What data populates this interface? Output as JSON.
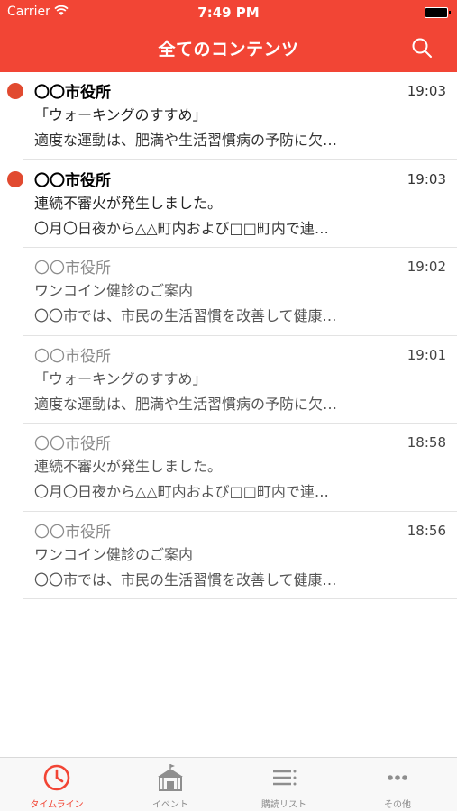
{
  "status_bar": {
    "carrier": "Carrier",
    "time": "7:49 PM"
  },
  "nav": {
    "title": "全てのコンテンツ",
    "search_icon": "search-icon"
  },
  "items": [
    {
      "sender": "〇〇市役所",
      "time": "19:03",
      "title": "「ウォーキングのすすめ」",
      "body": "適度な運動は、肥満や生活習慣病の予防に欠…",
      "unread": true
    },
    {
      "sender": "〇〇市役所",
      "time": "19:03",
      "title": "連続不審火が発生しました。",
      "body": "〇月〇日夜から△△町内および□□町内で連…",
      "unread": true
    },
    {
      "sender": "〇〇市役所",
      "time": "19:02",
      "title": "ワンコイン健診のご案内",
      "body": "〇〇市では、市民の生活習慣を改善して健康…",
      "unread": false
    },
    {
      "sender": "〇〇市役所",
      "time": "19:01",
      "title": "「ウォーキングのすすめ」",
      "body": "適度な運動は、肥満や生活習慣病の予防に欠…",
      "unread": false
    },
    {
      "sender": "〇〇市役所",
      "time": "18:58",
      "title": "連続不審火が発生しました。",
      "body": "〇月〇日夜から△△町内および□□町内で連…",
      "unread": false
    },
    {
      "sender": "〇〇市役所",
      "time": "18:56",
      "title": "ワンコイン健診のご案内",
      "body": "〇〇市では、市民の生活習慣を改善して健康…",
      "unread": false
    }
  ],
  "tabs": [
    {
      "label": "タイムライン",
      "icon": "clock-icon",
      "active": true
    },
    {
      "label": "イベント",
      "icon": "tent-icon",
      "active": false
    },
    {
      "label": "購読リスト",
      "icon": "list-icon",
      "active": false
    },
    {
      "label": "その他",
      "icon": "more-icon",
      "active": false
    }
  ],
  "colors": {
    "accent": "#f24535",
    "unread_dot": "#e14a30",
    "inactive_tab": "#8e8e8e"
  }
}
